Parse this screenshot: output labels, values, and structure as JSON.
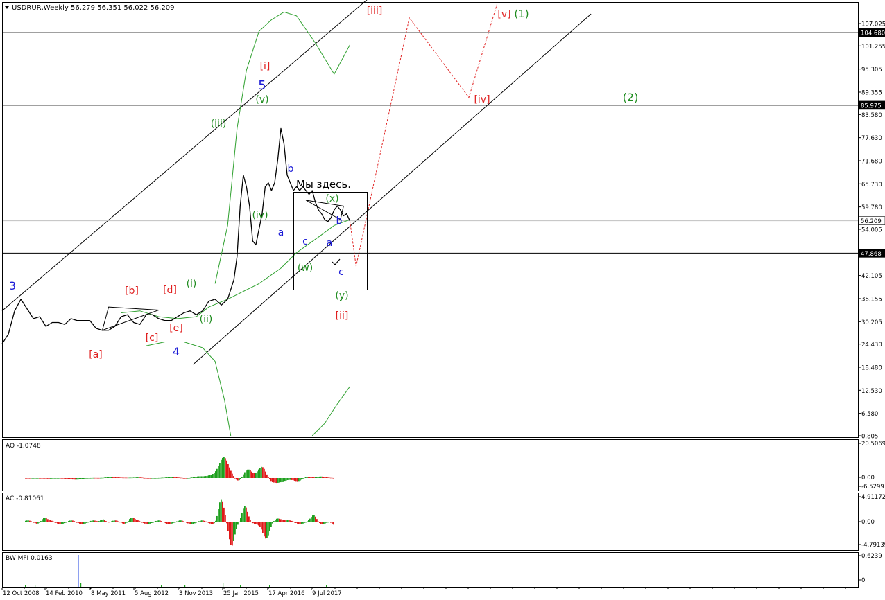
{
  "title": "USDRUR,Weekly  56.279 56.351 56.022 56.209",
  "main_chart": {
    "y_axis_ticks": [
      "107.025",
      "101.255",
      "95.305",
      "89.355",
      "83.580",
      "77.630",
      "71.680",
      "65.730",
      "59.780",
      "54.005",
      "48.055",
      "42.105",
      "36.155",
      "30.205",
      "24.430",
      "18.480",
      "12.530",
      "6.580",
      "0.805"
    ],
    "price_tags": [
      {
        "label": "104.680",
        "value": 104.68,
        "kind": "hline"
      },
      {
        "label": "85.975",
        "value": 85.975,
        "kind": "hline"
      },
      {
        "label": "56.209",
        "value": 56.209,
        "kind": "current"
      },
      {
        "label": "47.868",
        "value": 47.868,
        "kind": "hline"
      }
    ],
    "annotation_text": "Мы здесь.",
    "wave_labels": [
      {
        "text": "3",
        "color": "#1b1bd6"
      },
      {
        "text": "[a]",
        "color": "#e02020"
      },
      {
        "text": "[b]",
        "color": "#e02020"
      },
      {
        "text": "[c]",
        "color": "#e02020"
      },
      {
        "text": "[d]",
        "color": "#e02020"
      },
      {
        "text": "[e]",
        "color": "#e02020"
      },
      {
        "text": "4",
        "color": "#1b1bd6"
      },
      {
        "text": "(i)",
        "color": "#1e8c1e"
      },
      {
        "text": "(ii)",
        "color": "#1e8c1e"
      },
      {
        "text": "(iii)",
        "color": "#1e8c1e"
      },
      {
        "text": "(iv)",
        "color": "#1e8c1e"
      },
      {
        "text": "(v)",
        "color": "#1e8c1e"
      },
      {
        "text": "5",
        "color": "#1b1bd6"
      },
      {
        "text": "[i]",
        "color": "#e02020"
      },
      {
        "text": "a",
        "color": "#1b1bd6"
      },
      {
        "text": "b",
        "color": "#1b1bd6"
      },
      {
        "text": "c",
        "color": "#1b1bd6"
      },
      {
        "text": "(w)",
        "color": "#1e8c1e"
      },
      {
        "text": "(x)",
        "color": "#1e8c1e"
      },
      {
        "text": "a",
        "color": "#1b1bd6"
      },
      {
        "text": "b",
        "color": "#1b1bd6"
      },
      {
        "text": "c",
        "color": "#1b1bd6"
      },
      {
        "text": "(y)",
        "color": "#1e8c1e"
      },
      {
        "text": "[ii]",
        "color": "#e02020"
      },
      {
        "text": "[iii]",
        "color": "#e02020"
      },
      {
        "text": "[iv]",
        "color": "#e02020"
      },
      {
        "text": "[v]",
        "color": "#e02020"
      },
      {
        "text": "(1)",
        "color": "#1e8c1e"
      },
      {
        "text": "(2)",
        "color": "#1e8c1e"
      }
    ]
  },
  "ao_pane": {
    "label": "AO -1.0748",
    "ticks": [
      "20.5069",
      "0.00",
      "-6.5299"
    ]
  },
  "ac_pane": {
    "label": "AC -0.81061",
    "ticks": [
      "4.91172",
      "0.00",
      "-4.79139"
    ]
  },
  "mfi_pane": {
    "label": "BW MFI 0.0163",
    "ticks": [
      "0.6239",
      "0"
    ]
  },
  "x_axis_dates": [
    "12 Oct 2008",
    "14 Feb 2010",
    "8 May 2011",
    "5 Aug 2012",
    "3 Nov 2013",
    "25 Jan 2015",
    "17 Apr 2016",
    "9 Jul 2017"
  ],
  "colors": {
    "price_line": "#000000",
    "bands": "#2ea02e",
    "projection": "#e02020",
    "bull": "#1ea01e",
    "bear": "#e01818",
    "background": "#ffffff"
  },
  "chart_data": {
    "type": "line",
    "title": "USDRUR,Weekly",
    "ohlc_last": {
      "open": 56.279,
      "high": 56.351,
      "low": 56.022,
      "close": 56.209
    },
    "ylim": [
      0.805,
      110.0
    ],
    "x": [
      "2008-08",
      "2008-10",
      "2008-12",
      "2009-02",
      "2009-04",
      "2009-06",
      "2009-08",
      "2009-10",
      "2009-12",
      "2010-02",
      "2010-04",
      "2010-06",
      "2010-08",
      "2010-10",
      "2010-12",
      "2011-02",
      "2011-04",
      "2011-06",
      "2011-08",
      "2011-10",
      "2011-12",
      "2012-02",
      "2012-04",
      "2012-06",
      "2012-08",
      "2012-10",
      "2012-12",
      "2013-02",
      "2013-04",
      "2013-06",
      "2013-08",
      "2013-10",
      "2013-12",
      "2014-02",
      "2014-04",
      "2014-06",
      "2014-08",
      "2014-10",
      "2014-11",
      "2014-12",
      "2015-01",
      "2015-02",
      "2015-03",
      "2015-04",
      "2015-05",
      "2015-06",
      "2015-07",
      "2015-08",
      "2015-09",
      "2015-10",
      "2015-11",
      "2015-12",
      "2016-01",
      "2016-02",
      "2016-03",
      "2016-04",
      "2016-05",
      "2016-06",
      "2016-07",
      "2016-08",
      "2016-09",
      "2016-10",
      "2016-11",
      "2016-12",
      "2017-01",
      "2017-02",
      "2017-03",
      "2017-04",
      "2017-05",
      "2017-06",
      "2017-07",
      "2017-08",
      "2017-09",
      "2017-10",
      "2017-11"
    ],
    "series": [
      {
        "values": [
          24.5,
          27.0,
          33.0,
          36.0,
          33.5,
          31.0,
          31.5,
          29.0,
          30.0,
          30.0,
          29.5,
          31.0,
          30.5,
          30.5,
          30.5,
          28.5,
          28.0,
          28.0,
          29.0,
          31.5,
          32.0,
          30.0,
          29.5,
          32.0,
          32.0,
          31.0,
          30.5,
          30.5,
          31.5,
          32.5,
          33.0,
          32.0,
          33.0,
          35.5,
          36.0,
          34.5,
          36.0,
          41.0,
          47.0,
          60.0,
          68.0,
          65.0,
          60.0,
          51.0,
          50.0,
          54.0,
          58.0,
          65.0,
          66.0,
          64.0,
          66.0,
          72.0,
          80.0,
          76.0,
          68.0,
          66.0,
          64.0,
          65.0,
          64.0,
          65.0,
          64.0,
          63.0,
          64.0,
          61.0,
          59.0,
          58.0,
          56.5,
          56.0,
          57.0,
          59.0,
          60.0,
          59.0,
          57.5,
          58.0,
          56.2
        ]
      },
      {
        "name": "projection",
        "values_note": "",
        "points": [
          {
            "x": "2017-11",
            "y": 56.2
          },
          {
            "x": "2018-01",
            "y": 44.5
          },
          {
            "x": "2019-06",
            "y": 108.5
          },
          {
            "x": "2021-01",
            "y": 88.0
          },
          {
            "x": "2021-10",
            "y": 112.0
          }
        ]
      }
    ]
  }
}
